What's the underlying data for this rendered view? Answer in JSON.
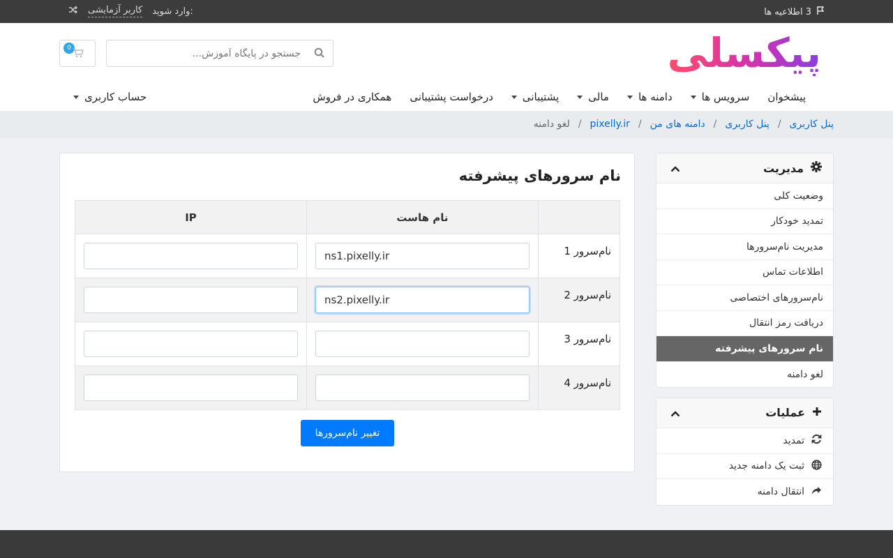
{
  "topbar": {
    "notifications": "3 اطلاعیه ها",
    "login_label": "وارد شوید:",
    "user_name": "کاربر آزمایشی"
  },
  "header": {
    "logo_text": "پیکسلی",
    "search_placeholder": "جستجو در پایگاه آموزش...",
    "cart_count": "0"
  },
  "nav": {
    "items": [
      {
        "label": "پیشخوان"
      },
      {
        "label": "سرویس ها"
      },
      {
        "label": "دامنه ها"
      },
      {
        "label": "مالی"
      },
      {
        "label": "پشتیبانی"
      },
      {
        "label": "درخواست پشتیبانی"
      },
      {
        "label": "همکاری در فروش"
      }
    ],
    "account": "حساب کاربری"
  },
  "breadcrumb": {
    "items": [
      "پنل کاربری",
      "پنل کاربری",
      "دامنه های من",
      "pixelly.ir"
    ],
    "current": "لغو دامنه"
  },
  "sidebar": {
    "manage": {
      "title": "مدیریت",
      "items": [
        "وضعیت کلی",
        "تمدید خودکار",
        "مدیریت نام‌سرورها",
        "اطلاعات تماس",
        "نام‌سرورهای اختصاصی",
        "دریافت رمز انتقال",
        "نام سرورهای پیشرفته",
        "لغو دامنه"
      ]
    },
    "actions": {
      "title": "عملیات",
      "items": [
        "تمدید",
        "ثبت یک دامنه جدید",
        "انتقال دامنه"
      ]
    }
  },
  "main": {
    "title": "نام سرورهای پیشرفته",
    "col_host": "نام هاست",
    "col_ip": "IP",
    "rows": [
      {
        "label": "نام‌سرور 1",
        "host": "ns1.pixelly.ir",
        "ip": ""
      },
      {
        "label": "نام‌سرور 2",
        "host": "ns2.pixelly.ir",
        "ip": ""
      },
      {
        "label": "نام‌سرور 3",
        "host": "",
        "ip": ""
      },
      {
        "label": "نام‌سرور 4",
        "host": "",
        "ip": ""
      }
    ],
    "submit": "تغییر نام‌سرورها"
  },
  "colors": {
    "primary": "#007bff",
    "topbar": "#3c3c3c",
    "active_item": "#666666"
  }
}
